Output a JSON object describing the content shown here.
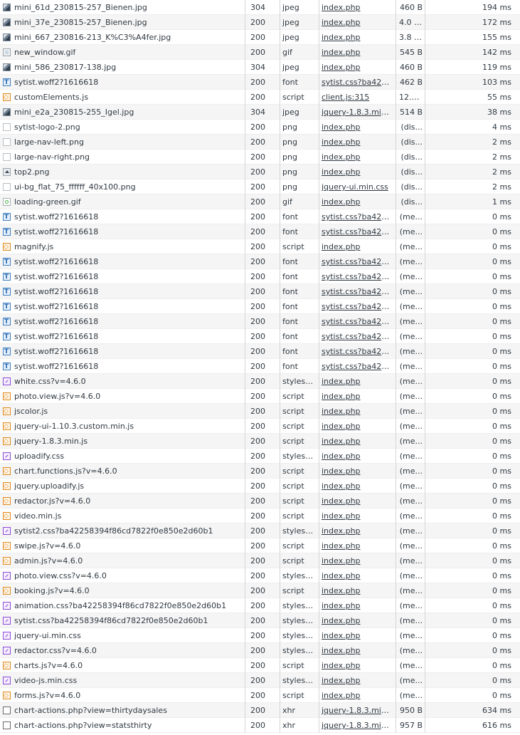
{
  "rows": [
    {
      "name": "mini_61d_230815-257_Bienen.jpg",
      "status": "304",
      "type": "jpeg",
      "initiator": "index.php",
      "size": "460 B",
      "time": "194 ms",
      "icon": "image-file-icon"
    },
    {
      "name": "mini_37e_230815-257_Bienen.jpg",
      "status": "200",
      "type": "jpeg",
      "initiator": "index.php",
      "size": "4.0 kB",
      "time": "172 ms",
      "icon": "image-file-icon"
    },
    {
      "name": "mini_667_230816-213_K%C3%A4fer.jpg",
      "status": "200",
      "type": "jpeg",
      "initiator": "index.php",
      "size": "3.8 kB",
      "time": "155 ms",
      "icon": "image-file-icon"
    },
    {
      "name": "new_window.gif",
      "status": "200",
      "type": "gif",
      "initiator": "index.php",
      "size": "545 B",
      "time": "142 ms",
      "icon": "gif-file-icon"
    },
    {
      "name": "mini_586_230817-138.jpg",
      "status": "304",
      "type": "jpeg",
      "initiator": "index.php",
      "size": "460 B",
      "time": "119 ms",
      "icon": "image-file-icon"
    },
    {
      "name": "sytist.woff2?1616618",
      "status": "200",
      "type": "font",
      "initiator": "sytist.css?ba4225...",
      "size": "462 B",
      "time": "103 ms",
      "icon": "font-file-icon"
    },
    {
      "name": "customElements.js",
      "status": "200",
      "type": "script",
      "initiator": "client.js:315",
      "size": "12.0...",
      "time": "55 ms",
      "icon": "script-file-icon"
    },
    {
      "name": "mini_e2a_230815-255_Igel.jpg",
      "status": "304",
      "type": "jpeg",
      "initiator": "jquery-1.8.3.min....",
      "size": "514 B",
      "time": "38 ms",
      "icon": "image-file-icon"
    },
    {
      "name": "sytist-logo-2.png",
      "status": "200",
      "type": "png",
      "initiator": "index.php",
      "size": "(dis...",
      "time": "4 ms",
      "icon": "png-file-icon"
    },
    {
      "name": "large-nav-left.png",
      "status": "200",
      "type": "png",
      "initiator": "index.php",
      "size": "(dis...",
      "time": "2 ms",
      "icon": "png-file-icon"
    },
    {
      "name": "large-nav-right.png",
      "status": "200",
      "type": "png",
      "initiator": "index.php",
      "size": "(dis...",
      "time": "2 ms",
      "icon": "png-file-icon"
    },
    {
      "name": "top2.png",
      "status": "200",
      "type": "png",
      "initiator": "index.php",
      "size": "(dis...",
      "time": "2 ms",
      "icon": "png-up-file-icon"
    },
    {
      "name": "ui-bg_flat_75_ffffff_40x100.png",
      "status": "200",
      "type": "png",
      "initiator": "jquery-ui.min.css",
      "size": "(dis...",
      "time": "2 ms",
      "icon": "png-file-icon"
    },
    {
      "name": "loading-green.gif",
      "status": "200",
      "type": "gif",
      "initiator": "index.php",
      "size": "(dis...",
      "time": "1 ms",
      "icon": "gif-loading-icon"
    },
    {
      "name": "sytist.woff2?1616618",
      "status": "200",
      "type": "font",
      "initiator": "sytist.css?ba4225...",
      "size": "(me...",
      "time": "0 ms",
      "icon": "font-file-icon"
    },
    {
      "name": "sytist.woff2?1616618",
      "status": "200",
      "type": "font",
      "initiator": "sytist.css?ba4225...",
      "size": "(me...",
      "time": "0 ms",
      "icon": "font-file-icon"
    },
    {
      "name": "magnify.js",
      "status": "200",
      "type": "script",
      "initiator": "index.php",
      "size": "(me...",
      "time": "0 ms",
      "icon": "script-file-icon"
    },
    {
      "name": "sytist.woff2?1616618",
      "status": "200",
      "type": "font",
      "initiator": "sytist.css?ba4225...",
      "size": "(me...",
      "time": "0 ms",
      "icon": "font-file-icon"
    },
    {
      "name": "sytist.woff2?1616618",
      "status": "200",
      "type": "font",
      "initiator": "sytist.css?ba4225...",
      "size": "(me...",
      "time": "0 ms",
      "icon": "font-file-icon"
    },
    {
      "name": "sytist.woff2?1616618",
      "status": "200",
      "type": "font",
      "initiator": "sytist.css?ba4225...",
      "size": "(me...",
      "time": "0 ms",
      "icon": "font-file-icon"
    },
    {
      "name": "sytist.woff2?1616618",
      "status": "200",
      "type": "font",
      "initiator": "sytist.css?ba4225...",
      "size": "(me...",
      "time": "0 ms",
      "icon": "font-file-icon"
    },
    {
      "name": "sytist.woff2?1616618",
      "status": "200",
      "type": "font",
      "initiator": "sytist.css?ba4225...",
      "size": "(me...",
      "time": "0 ms",
      "icon": "font-file-icon"
    },
    {
      "name": "sytist.woff2?1616618",
      "status": "200",
      "type": "font",
      "initiator": "sytist.css?ba4225...",
      "size": "(me...",
      "time": "0 ms",
      "icon": "font-file-icon"
    },
    {
      "name": "sytist.woff2?1616618",
      "status": "200",
      "type": "font",
      "initiator": "sytist.css?ba4225...",
      "size": "(me...",
      "time": "0 ms",
      "icon": "font-file-icon"
    },
    {
      "name": "sytist.woff2?1616618",
      "status": "200",
      "type": "font",
      "initiator": "sytist.css?ba4225...",
      "size": "(me...",
      "time": "0 ms",
      "icon": "font-file-icon"
    },
    {
      "name": "white.css?v=4.6.0",
      "status": "200",
      "type": "stylesh...",
      "initiator": "index.php",
      "size": "(me...",
      "time": "0 ms",
      "icon": "stylesheet-file-icon"
    },
    {
      "name": "photo.view.js?v=4.6.0",
      "status": "200",
      "type": "script",
      "initiator": "index.php",
      "size": "(me...",
      "time": "0 ms",
      "icon": "script-file-icon"
    },
    {
      "name": "jscolor.js",
      "status": "200",
      "type": "script",
      "initiator": "index.php",
      "size": "(me...",
      "time": "0 ms",
      "icon": "script-file-icon"
    },
    {
      "name": "jquery-ui-1.10.3.custom.min.js",
      "status": "200",
      "type": "script",
      "initiator": "index.php",
      "size": "(me...",
      "time": "0 ms",
      "icon": "script-file-icon"
    },
    {
      "name": "jquery-1.8.3.min.js",
      "status": "200",
      "type": "script",
      "initiator": "index.php",
      "size": "(me...",
      "time": "0 ms",
      "icon": "script-file-icon"
    },
    {
      "name": "uploadify.css",
      "status": "200",
      "type": "stylesh...",
      "initiator": "index.php",
      "size": "(me...",
      "time": "0 ms",
      "icon": "stylesheet-file-icon"
    },
    {
      "name": "chart.functions.js?v=4.6.0",
      "status": "200",
      "type": "script",
      "initiator": "index.php",
      "size": "(me...",
      "time": "0 ms",
      "icon": "script-file-icon"
    },
    {
      "name": "jquery.uploadify.js",
      "status": "200",
      "type": "script",
      "initiator": "index.php",
      "size": "(me...",
      "time": "0 ms",
      "icon": "script-file-icon"
    },
    {
      "name": "redactor.js?v=4.6.0",
      "status": "200",
      "type": "script",
      "initiator": "index.php",
      "size": "(me...",
      "time": "0 ms",
      "icon": "script-file-icon"
    },
    {
      "name": "video.min.js",
      "status": "200",
      "type": "script",
      "initiator": "index.php",
      "size": "(me...",
      "time": "0 ms",
      "icon": "script-file-icon"
    },
    {
      "name": "sytist2.css?ba42258394f86cd7822f0e850e2d60b1",
      "status": "200",
      "type": "stylesh...",
      "initiator": "index.php",
      "size": "(me...",
      "time": "0 ms",
      "icon": "stylesheet-file-icon"
    },
    {
      "name": "swipe.js?v=4.6.0",
      "status": "200",
      "type": "script",
      "initiator": "index.php",
      "size": "(me...",
      "time": "0 ms",
      "icon": "script-file-icon"
    },
    {
      "name": "admin.js?v=4.6.0",
      "status": "200",
      "type": "script",
      "initiator": "index.php",
      "size": "(me...",
      "time": "0 ms",
      "icon": "script-file-icon"
    },
    {
      "name": "photo.view.css?v=4.6.0",
      "status": "200",
      "type": "stylesh...",
      "initiator": "index.php",
      "size": "(me...",
      "time": "0 ms",
      "icon": "stylesheet-file-icon"
    },
    {
      "name": "booking.js?v=4.6.0",
      "status": "200",
      "type": "script",
      "initiator": "index.php",
      "size": "(me...",
      "time": "0 ms",
      "icon": "script-file-icon"
    },
    {
      "name": "animation.css?ba42258394f86cd7822f0e850e2d60b1",
      "status": "200",
      "type": "stylesh...",
      "initiator": "index.php",
      "size": "(me...",
      "time": "0 ms",
      "icon": "stylesheet-file-icon"
    },
    {
      "name": "sytist.css?ba42258394f86cd7822f0e850e2d60b1",
      "status": "200",
      "type": "stylesh...",
      "initiator": "index.php",
      "size": "(me...",
      "time": "0 ms",
      "icon": "stylesheet-file-icon"
    },
    {
      "name": "jquery-ui.min.css",
      "status": "200",
      "type": "stylesh...",
      "initiator": "index.php",
      "size": "(me...",
      "time": "0 ms",
      "icon": "stylesheet-file-icon"
    },
    {
      "name": "redactor.css?v=4.6.0",
      "status": "200",
      "type": "stylesh...",
      "initiator": "index.php",
      "size": "(me...",
      "time": "0 ms",
      "icon": "stylesheet-file-icon"
    },
    {
      "name": "charts.js?v=4.6.0",
      "status": "200",
      "type": "script",
      "initiator": "index.php",
      "size": "(me...",
      "time": "0 ms",
      "icon": "script-file-icon"
    },
    {
      "name": "video-js.min.css",
      "status": "200",
      "type": "stylesh...",
      "initiator": "index.php",
      "size": "(me...",
      "time": "0 ms",
      "icon": "stylesheet-file-icon"
    },
    {
      "name": "forms.js?v=4.6.0",
      "status": "200",
      "type": "script",
      "initiator": "index.php",
      "size": "(me...",
      "time": "0 ms",
      "icon": "script-file-icon"
    },
    {
      "name": "chart-actions.php?view=thirtydaysales",
      "status": "200",
      "type": "xhr",
      "initiator": "jquery-1.8.3.min....",
      "size": "950 B",
      "time": "634 ms",
      "icon": "xhr-file-icon"
    },
    {
      "name": "chart-actions.php?view=statsthirty",
      "status": "200",
      "type": "xhr",
      "initiator": "jquery-1.8.3.min....",
      "size": "957 B",
      "time": "616 ms",
      "icon": "xhr-file-icon"
    }
  ],
  "colors": {
    "text": "#303942",
    "row_alt": "#f5f5f5",
    "font_icon": "#2a6bb0",
    "script_icon": "#e08a1e",
    "stylesheet_icon": "#8e4ad6"
  }
}
